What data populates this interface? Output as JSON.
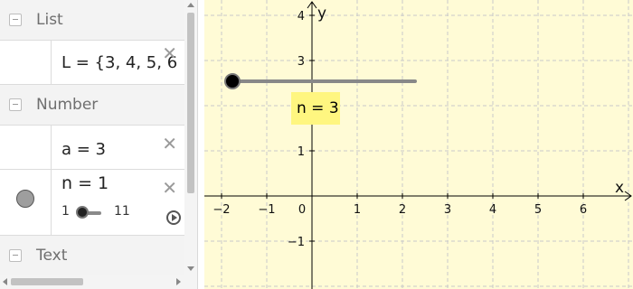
{
  "algebra": {
    "categories": {
      "list": "List",
      "number": "Number",
      "text": "Text"
    },
    "rows": {
      "list_L": {
        "expr": "L = {3, 4, 5, 6"
      },
      "number_a": {
        "expr": "a = 3"
      },
      "slider_n": {
        "expr": "n = 1",
        "min": "1",
        "max": "11",
        "value": 1
      }
    },
    "close_glyph": "✕"
  },
  "graphics": {
    "background": "#fffbd6",
    "x_axis_label": "x",
    "y_axis_label": "y",
    "x_ticks": [
      "−2",
      "−1",
      "0",
      "1",
      "2",
      "3",
      "4",
      "5",
      "6"
    ],
    "y_ticks": [
      "4",
      "3",
      "2",
      "1",
      "−1"
    ],
    "slider_label": "n = 3",
    "slider_value": 3,
    "slider_point_color": "#000000",
    "slider_line_color": "#888888"
  }
}
